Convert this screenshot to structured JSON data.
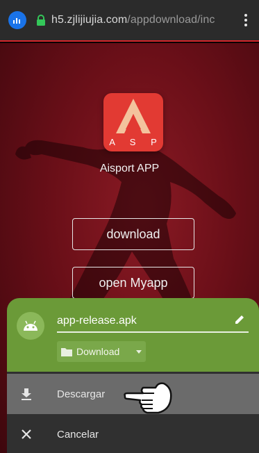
{
  "browser": {
    "url_host": "h5.zjlijiujia.com",
    "url_path": "/appdownload/inc",
    "icons": {
      "home": "home-badge-icon",
      "lock": "lock-icon",
      "menu": "more-vertical-icon"
    },
    "accent_color": "#d7262b"
  },
  "hero": {
    "logo_text": "A S P",
    "app_name": "Aisport APP",
    "download_label": "download",
    "open_label": "open Myapp",
    "colors": {
      "background": "#6a0f18",
      "logo": "#e23a33"
    }
  },
  "download_sheet": {
    "file_name": "app-release.apk",
    "folder": "Download",
    "download_action": "Descargar",
    "cancel_action": "Cancelar",
    "icons": {
      "avatar": "android-icon",
      "edit": "pencil-icon",
      "folder": "folder-icon",
      "download": "download-arrow-icon",
      "cancel": "close-icon",
      "pointer": "pointing-hand-icon"
    },
    "colors": {
      "header": "#6b9a38",
      "selected_row": "#6b6b6b"
    }
  }
}
